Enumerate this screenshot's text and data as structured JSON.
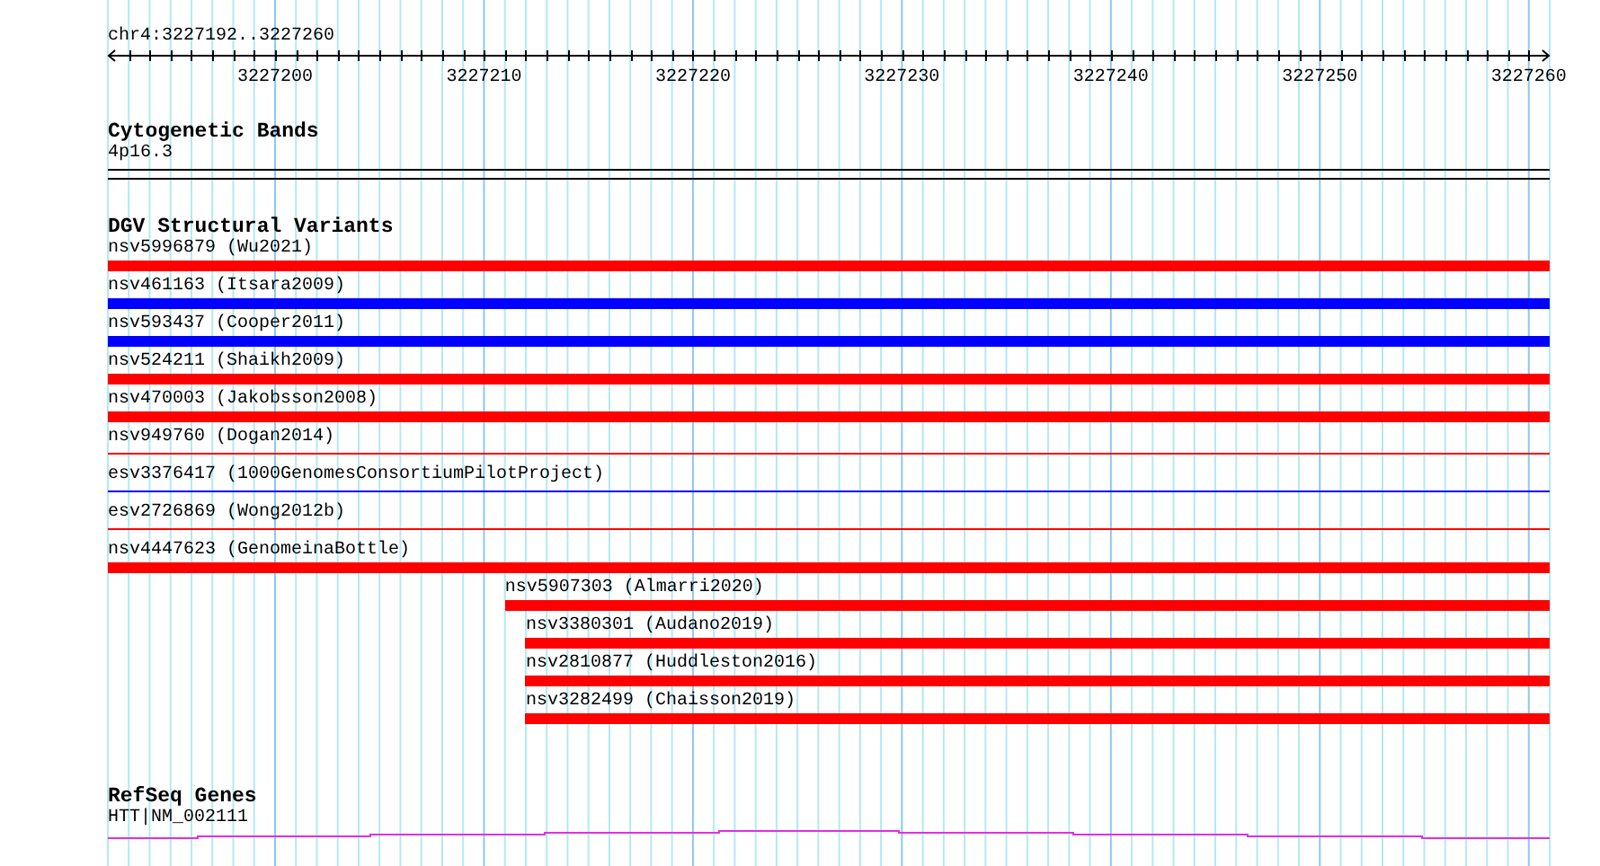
{
  "ruler": {
    "region": "chr4:3227192..3227260",
    "ticks": [
      "3227200",
      "3227210",
      "3227220",
      "3227230",
      "3227240",
      "3227250",
      "3227260"
    ]
  },
  "tracks": [
    {
      "kind": "bands",
      "title": "Cytogenetic Bands",
      "bands": [
        {
          "label": "4p16.3"
        }
      ]
    },
    {
      "kind": "variants",
      "title": "DGV Structural Variants",
      "features": [
        {
          "label": "nsv5996879 (Wu2021)",
          "kind": "thick",
          "color": "#ff0000"
        },
        {
          "label": "nsv461163 (Itsara2009)",
          "kind": "thick",
          "color": "#0000ff"
        },
        {
          "label": "nsv593437 (Cooper2011)",
          "kind": "thick",
          "color": "#0000ff"
        },
        {
          "label": "nsv524211 (Shaikh2009)",
          "kind": "thick",
          "color": "#ff0000"
        },
        {
          "label": "nsv470003 (Jakobsson2008)",
          "kind": "thick",
          "color": "#ff0000"
        },
        {
          "label": "nsv949760 (Dogan2014)",
          "kind": "thin",
          "color": "#ff0000"
        },
        {
          "label": "esv3376417 (1000GenomesConsortiumPilotProject)",
          "kind": "thin",
          "color": "#0000ff"
        },
        {
          "label": "esv2726869 (Wong2012b)",
          "kind": "thin",
          "color": "#ff0000"
        },
        {
          "label": "nsv4447623 (GenomeinaBottle)",
          "kind": "thick",
          "color": "#ff0000"
        },
        {
          "label": "nsv5907303 (Almarri2020)",
          "kind": "thick",
          "color": "#ff0000"
        },
        {
          "label": "nsv3380301 (Audano2019)",
          "kind": "thick",
          "color": "#ff0000"
        },
        {
          "label": "nsv2810877 (Huddleston2016)",
          "kind": "thick",
          "color": "#ff0000"
        },
        {
          "label": "nsv3282499 (Chaisson2019)",
          "kind": "thick",
          "color": "#ff0000"
        }
      ]
    },
    {
      "kind": "genes",
      "title": "RefSeq Genes",
      "genes": [
        {
          "label": "HTT|NM_002111"
        }
      ]
    }
  ]
}
